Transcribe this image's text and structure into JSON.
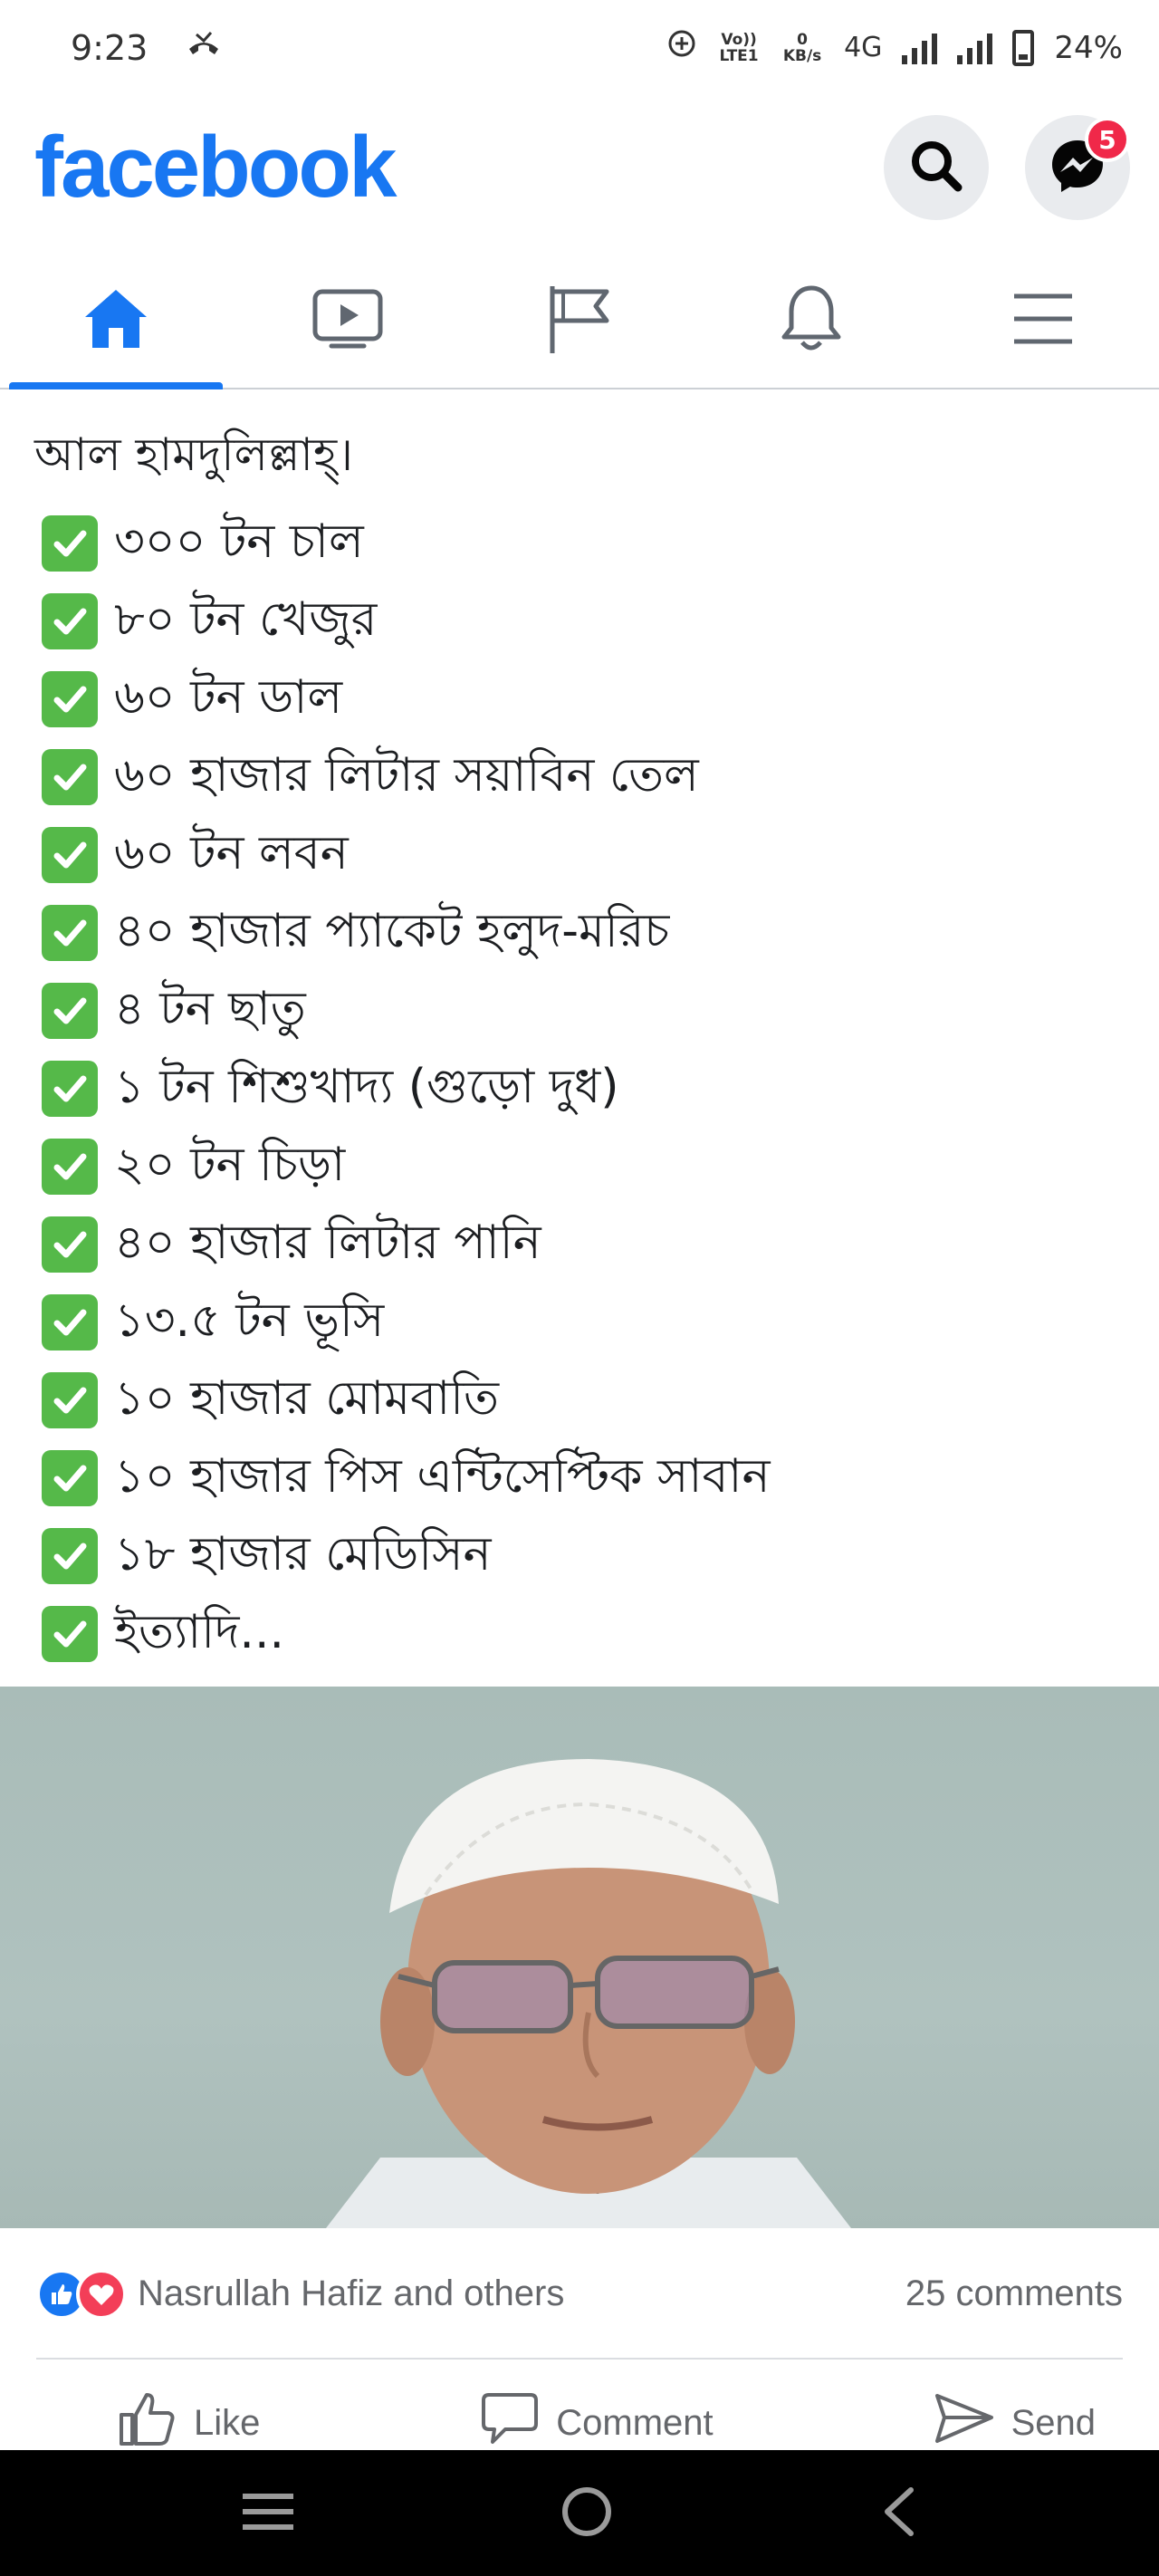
{
  "status_bar": {
    "time": "9:23",
    "volte_label": "Vo)) LTE1",
    "data_speed_value": "0",
    "data_speed_unit": "KB/s",
    "network": "4G",
    "battery": "24%"
  },
  "header": {
    "logo": "facebook",
    "messenger_badge": "5"
  },
  "tabs": [
    {
      "icon": "home-icon",
      "active": true
    },
    {
      "icon": "video-icon",
      "active": false
    },
    {
      "icon": "flag-icon",
      "active": false
    },
    {
      "icon": "bell-icon",
      "active": false
    },
    {
      "icon": "menu-icon",
      "active": false
    }
  ],
  "post": {
    "intro": "আল হামদুলিল্লাহ্।",
    "items": [
      "৩০০ টন চাল",
      "৮০ টন খেজুর",
      "৬০ টন ডাল",
      "৬০ হাজার লিটার সয়াবিন তেল",
      "৬০ টন লবন",
      "৪০ হাজার প্যাকেট হলুদ-মরিচ",
      "৪  টন ছাতু",
      "১ টন শিশুখাদ্য (গুড়ো দুধ)",
      "২০ টন চিড়া",
      "৪০ হাজার লিটার পানি",
      "১৩.৫ টন ভূসি",
      "১০ হাজার মোমবাতি",
      "১০ হাজার পিস এন্টিসেপ্টিক সাবান",
      "১৮ হাজার মেডিসিন",
      "ইত্যাদি..."
    ]
  },
  "reactions": {
    "names": "Nasrullah Hafiz and others",
    "comments": "25 comments"
  },
  "actions": {
    "like": "Like",
    "comment": "Comment",
    "send": "Send"
  },
  "colors": {
    "brand": "#1877f2",
    "check_green": "#55b949",
    "badge_red": "#f02849",
    "love_red": "#f33e58"
  }
}
